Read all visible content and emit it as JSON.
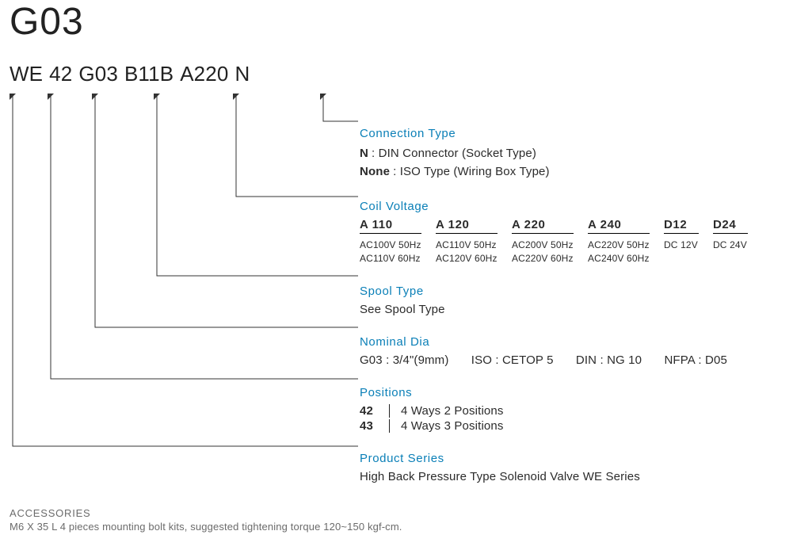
{
  "title": "G03",
  "code": {
    "segs": [
      "WE",
      "42",
      "G03",
      "B11B",
      "A220",
      "N"
    ]
  },
  "connection": {
    "title": "Connection Type",
    "lines": [
      {
        "key": "N",
        "val": "DIN  Connector (Socket Type)"
      },
      {
        "key": "None",
        "val": "ISO Type (Wiring Box Type)"
      }
    ]
  },
  "coil": {
    "title": "Coil Voltage",
    "cols": [
      {
        "head": "A 110",
        "vals": [
          "AC100V  50Hz",
          "AC110V  60Hz"
        ]
      },
      {
        "head": "A 120",
        "vals": [
          "AC110V  50Hz",
          "AC120V  60Hz"
        ]
      },
      {
        "head": "A 220",
        "vals": [
          "AC200V  50Hz",
          "AC220V  60Hz"
        ]
      },
      {
        "head": "A 240",
        "vals": [
          "AC220V  50Hz",
          "AC240V  60Hz"
        ]
      },
      {
        "head": "D12",
        "vals": [
          "DC 12V"
        ]
      },
      {
        "head": "D24",
        "vals": [
          "DC 24V"
        ]
      }
    ]
  },
  "spool": {
    "title": "Spool Type",
    "text": "See Spool Type"
  },
  "nominal": {
    "title": "Nominal Dia",
    "parts": [
      "G03 : 3/4\"(9mm)",
      "ISO : CETOP 5",
      "DIN : NG 10",
      "NFPA : D05"
    ]
  },
  "positions": {
    "title": "Positions",
    "rows": [
      {
        "k": "42",
        "v": "4 Ways 2 Positions"
      },
      {
        "k": "43",
        "v": "4 Ways 3 Positions"
      }
    ]
  },
  "series": {
    "title": "Product Series",
    "text": "High Back Pressure Type Solenoid Valve WE Series"
  },
  "accessories": {
    "title": "ACCESSORIES",
    "text": "M6 X 35 L 4 pieces mounting bolt kits, suggested tightening torque 120~150 kgf-cm."
  }
}
